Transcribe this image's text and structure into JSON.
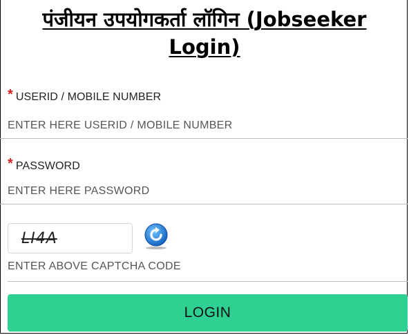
{
  "title": {
    "line1": "पंजीयन उपयोगकर्ता लॉगिन (Jobseeker",
    "line2": "Login)"
  },
  "userid": {
    "required_mark": "*",
    "label": "USERID / MOBILE NUMBER",
    "placeholder": "ENTER HERE USERID / MOBILE NUMBER",
    "value": ""
  },
  "password": {
    "required_mark": "*",
    "label": "PASSWORD",
    "placeholder": "ENTER HERE PASSWORD",
    "value": ""
  },
  "captcha": {
    "image_text": "LI4A",
    "hint": "ENTER ABOVE CAPTCHA CODE",
    "refresh_icon": "refresh-icon"
  },
  "login_button": {
    "label": "LOGIN"
  },
  "colors": {
    "login_button_bg": "#2ed192",
    "required_mark": "#d62020",
    "refresh_icon": "#1e88e5"
  }
}
